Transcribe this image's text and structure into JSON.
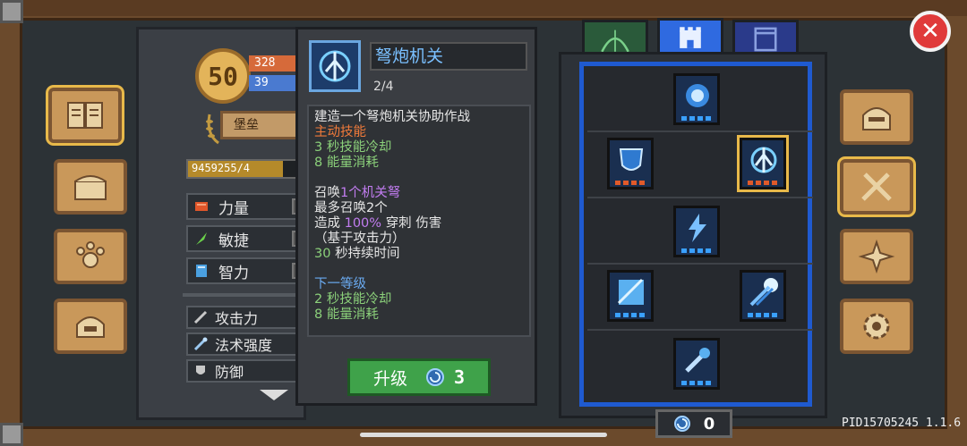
{
  "player": {
    "level": "50",
    "hp": "328",
    "mp": "39",
    "title": "堡垒",
    "exp_text": "9459255/4",
    "exp_fraction": 0.78
  },
  "stats": [
    {
      "label": "力量",
      "icon": "fist-icon"
    },
    {
      "label": "敏捷",
      "icon": "feather-icon"
    },
    {
      "label": "智力",
      "icon": "book-icon"
    }
  ],
  "attributes": [
    {
      "label": "攻击力",
      "icon": "sword-icon"
    },
    {
      "label": "法术强度",
      "icon": "wand-icon"
    },
    {
      "label": "防御",
      "icon": "shield-icon"
    }
  ],
  "skill": {
    "name": "弩炮机关",
    "level": "2/4",
    "desc_title": "建造一个弩炮机关协助作战",
    "type": "主动技能",
    "cooldown_num": "3",
    "cooldown_text": "秒技能冷却",
    "energy_num": "8",
    "energy_text": "能量消耗",
    "summon_prefix": "召唤",
    "summon_highlight": "1个机关弩",
    "summon_max": "最多召唤2个",
    "damage_prefix": "造成",
    "damage_pct": "100%",
    "damage_type": "穿刺",
    "damage_suffix": "伤害",
    "damage_note": "（基于攻击力）",
    "duration_num": "30",
    "duration_text": "秒持续时间",
    "next_level": "下一等级",
    "next_cooldown_num": "2",
    "next_cooldown_text": "秒技能冷却",
    "next_energy_num": "8",
    "next_energy_text": "能量消耗"
  },
  "upgrade": {
    "label": "升级",
    "cost": "3"
  },
  "skill_points": "0",
  "version": "PID15705245 1.1.6",
  "colors": {
    "panel_border": "#1f5ad0",
    "accent_gold": "#e8b94a",
    "upgrade_green": "#3fa24a",
    "close_red": "#e03a3a"
  }
}
